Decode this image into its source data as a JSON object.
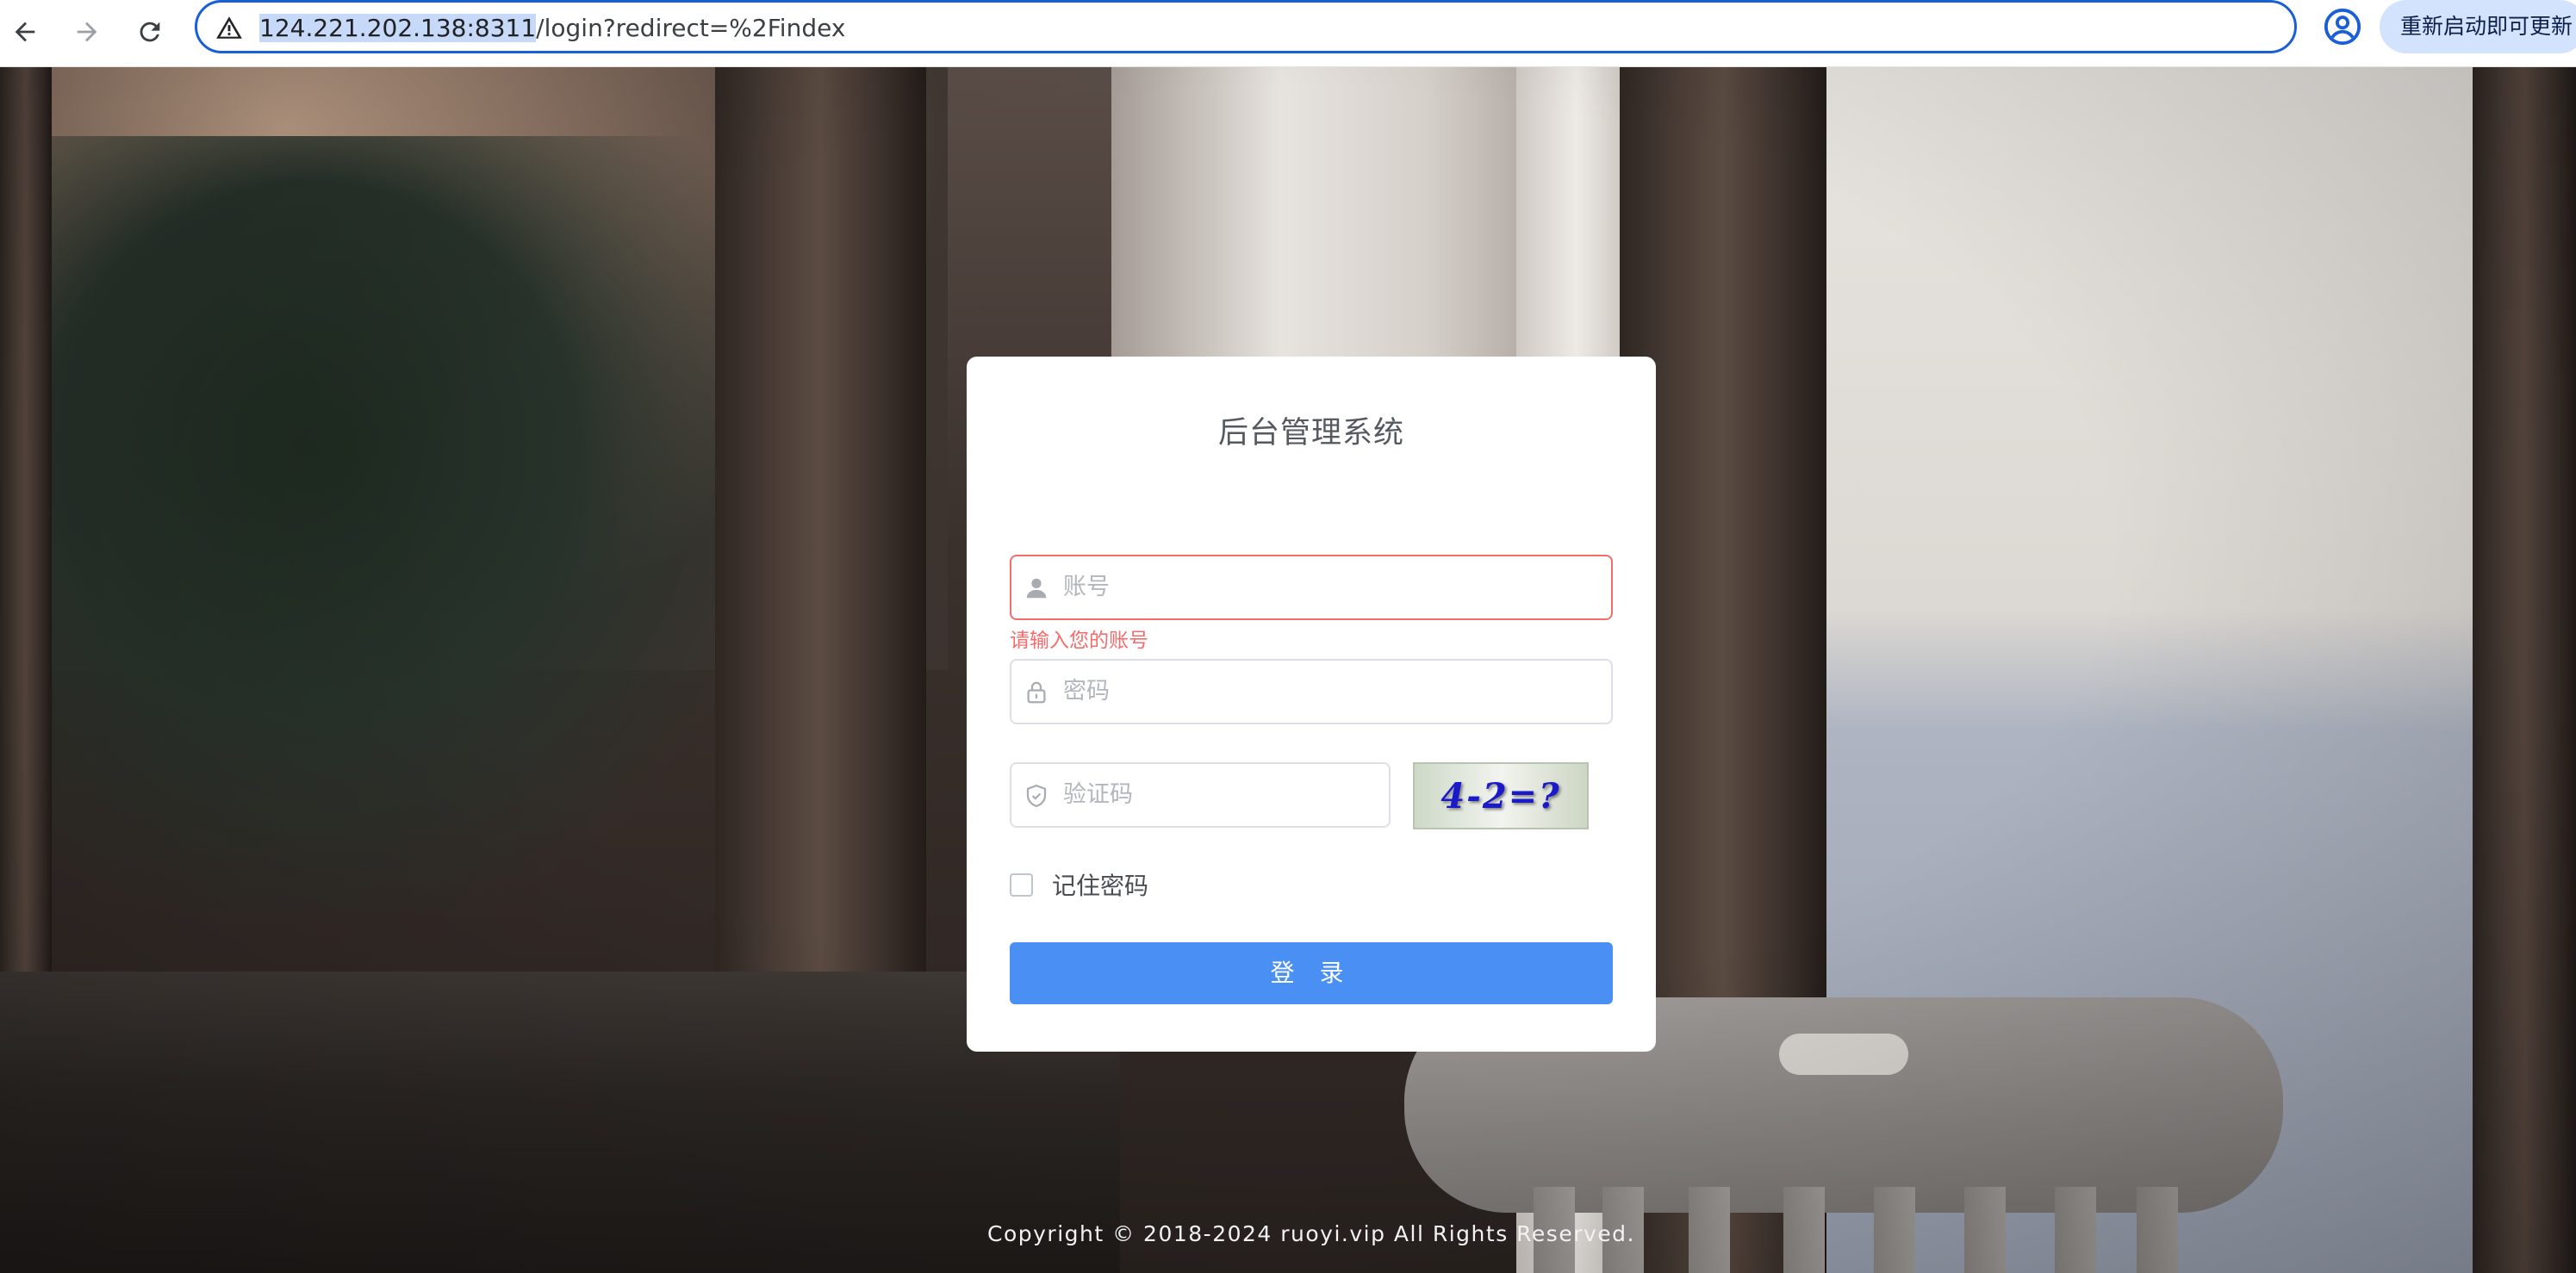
{
  "browser": {
    "url_host": "124.221.202.138:8311",
    "url_path": "/login?redirect=%2Findex",
    "update_button": "重新启动即可更新"
  },
  "login": {
    "title": "后台管理系统",
    "username_placeholder": "账号",
    "username_error": "请输入您的账号",
    "password_placeholder": "密码",
    "code_placeholder": "验证码",
    "captcha_text": "4-2=?",
    "remember_label": "记住密码",
    "login_button": "登 录"
  },
  "footer": {
    "copyright": "Copyright © 2018-2024 ruoyi.vip All Rights Reserved."
  },
  "colors": {
    "accent": "#4a90f4",
    "error": "#f56c6c",
    "omnibox_border": "#1a5fd6"
  }
}
